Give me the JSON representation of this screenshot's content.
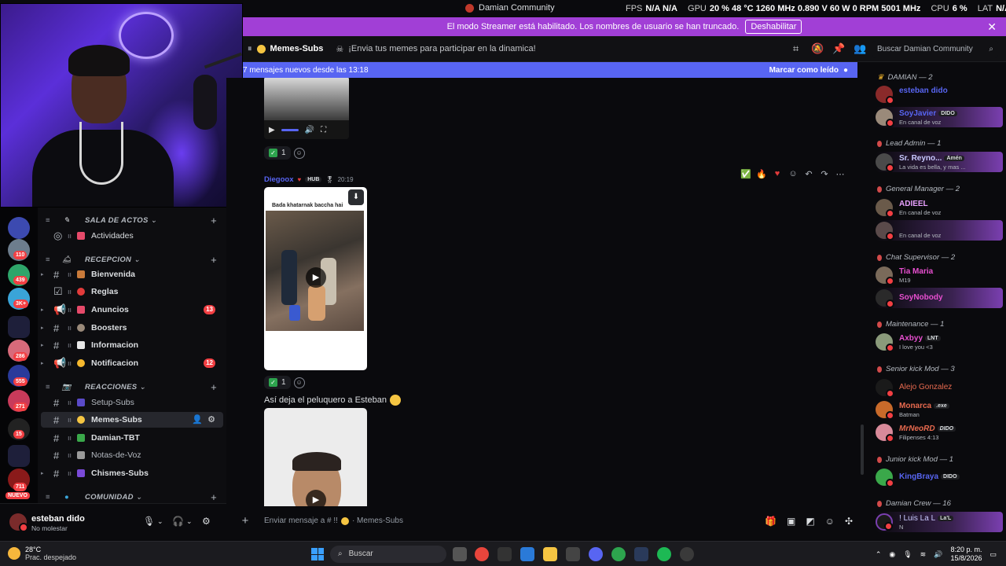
{
  "window": {
    "title": "Damian Community",
    "stats": [
      {
        "k": "FPS",
        "v": "N/A  N/A"
      },
      {
        "k": "GPU",
        "v": "20 %  48 °C  1260 MHz  0.890 V  60 W  0 RPM  5001 MHz"
      },
      {
        "k": "CPU",
        "v": "6 %"
      },
      {
        "k": "LAT",
        "v": "N/A  N/A"
      }
    ]
  },
  "banner": {
    "text": "El modo Streamer está habilitado. Los nombres de usuario se han truncado.",
    "button": "Deshabilitar",
    "close": "✕"
  },
  "channel": {
    "name": "Memes-Subs",
    "topic": "¡Envia tus memes para participar en la dinamica!",
    "search_placeholder": "Buscar Damian Community"
  },
  "new_messages": {
    "text": "7 mensajes nuevos desde las 13:18",
    "action": "Marcar como leído"
  },
  "server_rail": {
    "badges": [
      "110",
      "439",
      "3K+",
      "286",
      "555",
      "271",
      "15",
      "711"
    ],
    "new_label": "NUEVO"
  },
  "categories": [
    {
      "label": "SALA DE ACTOS"
    },
    {
      "label": "RECEPCION"
    },
    {
      "label": "REACCIONES"
    },
    {
      "label": "COMUNIDAD"
    }
  ],
  "channels": [
    {
      "label": "Actividades",
      "badge": ""
    },
    {
      "label": "Bienvenida",
      "badge": ""
    },
    {
      "label": "Reglas",
      "badge": ""
    },
    {
      "label": "Anuncios",
      "badge": "13"
    },
    {
      "label": "Boosters",
      "badge": ""
    },
    {
      "label": "Informacion",
      "badge": ""
    },
    {
      "label": "Notificacion",
      "badge": "12"
    },
    {
      "label": "Setup-Subs",
      "badge": ""
    },
    {
      "label": "Memes-Subs",
      "badge": ""
    },
    {
      "label": "Damian-TBT",
      "badge": ""
    },
    {
      "label": "Notas-de-Voz",
      "badge": ""
    },
    {
      "label": "Chismes-Subs",
      "badge": ""
    }
  ],
  "user": {
    "name": "esteban dido",
    "status": "No molestar"
  },
  "messages": {
    "reaction_count_1": "1",
    "reaction_count_2": "1",
    "author": "Diegoox",
    "author_tag": "HUB",
    "time": "20:19",
    "video_caption": "Bada khatarnak baccha hai",
    "text": "Así deja el peluquero a Esteban"
  },
  "composer": {
    "placeholder": "Enviar mensaje a # !! ",
    "channel": "· Memes-Subs"
  },
  "members": {
    "roles": [
      {
        "label": "DAMIAN — 2"
      },
      {
        "label": "Lead Admin — 1"
      },
      {
        "label": "General Manager — 2"
      },
      {
        "label": "Chat Supervisor — 2"
      },
      {
        "label": "Maintenance — 1"
      },
      {
        "label": "Senior kick Mod — 3"
      },
      {
        "label": "Junior kick Mod — 1"
      },
      {
        "label": "Damian Crew — 16"
      }
    ],
    "list": [
      {
        "name": "esteban dido",
        "sub": "",
        "badge": "",
        "color": "#5865f2"
      },
      {
        "name": "SoyJavier",
        "sub": "En canal de voz",
        "badge": "DIDO",
        "color": "#5865f2"
      },
      {
        "name": "Sr. Reyno...",
        "sub": "La vida es bella, y mas ...",
        "badge": "Amén",
        "color": "#c9c9ff"
      },
      {
        "name": "ADIEEL",
        "sub": "En canal de voz",
        "badge": "",
        "color": "#e8a0ff"
      },
      {
        "name": "",
        "sub": "En canal de voz",
        "badge": "",
        "color": "#5865f2"
      },
      {
        "name": "Tia Maria",
        "sub": "M19",
        "badge": "",
        "color": "#e84fd0"
      },
      {
        "name": "SoyNobody",
        "sub": "",
        "badge": "",
        "color": "#e84fd0"
      },
      {
        "name": "Axbyy",
        "sub": "I love you <3",
        "badge": "LNT",
        "color": "#e84fd0"
      },
      {
        "name": "Alejo Gonzalez",
        "sub": "",
        "badge": "",
        "color": "#e86a4f"
      },
      {
        "name": "Monarca",
        "sub": "Batman",
        "badge": ".exe",
        "color": "#e86a4f"
      },
      {
        "name": "MrNeoRD",
        "sub": "Filipenses 4:13",
        "badge": "DIDO",
        "color": "#e86a4f"
      },
      {
        "name": "KingBraya",
        "sub": "",
        "badge": "DIDO",
        "color": "#5865f2"
      },
      {
        "name": "! Luis La L",
        "sub": "N",
        "badge": "La'L",
        "color": "#c9c9ff"
      }
    ]
  },
  "taskbar": {
    "temp": "28°C",
    "weather": "Prac. despejado",
    "search": "Buscar",
    "time": "8:20 p. m.",
    "date": "15/8/2026"
  }
}
